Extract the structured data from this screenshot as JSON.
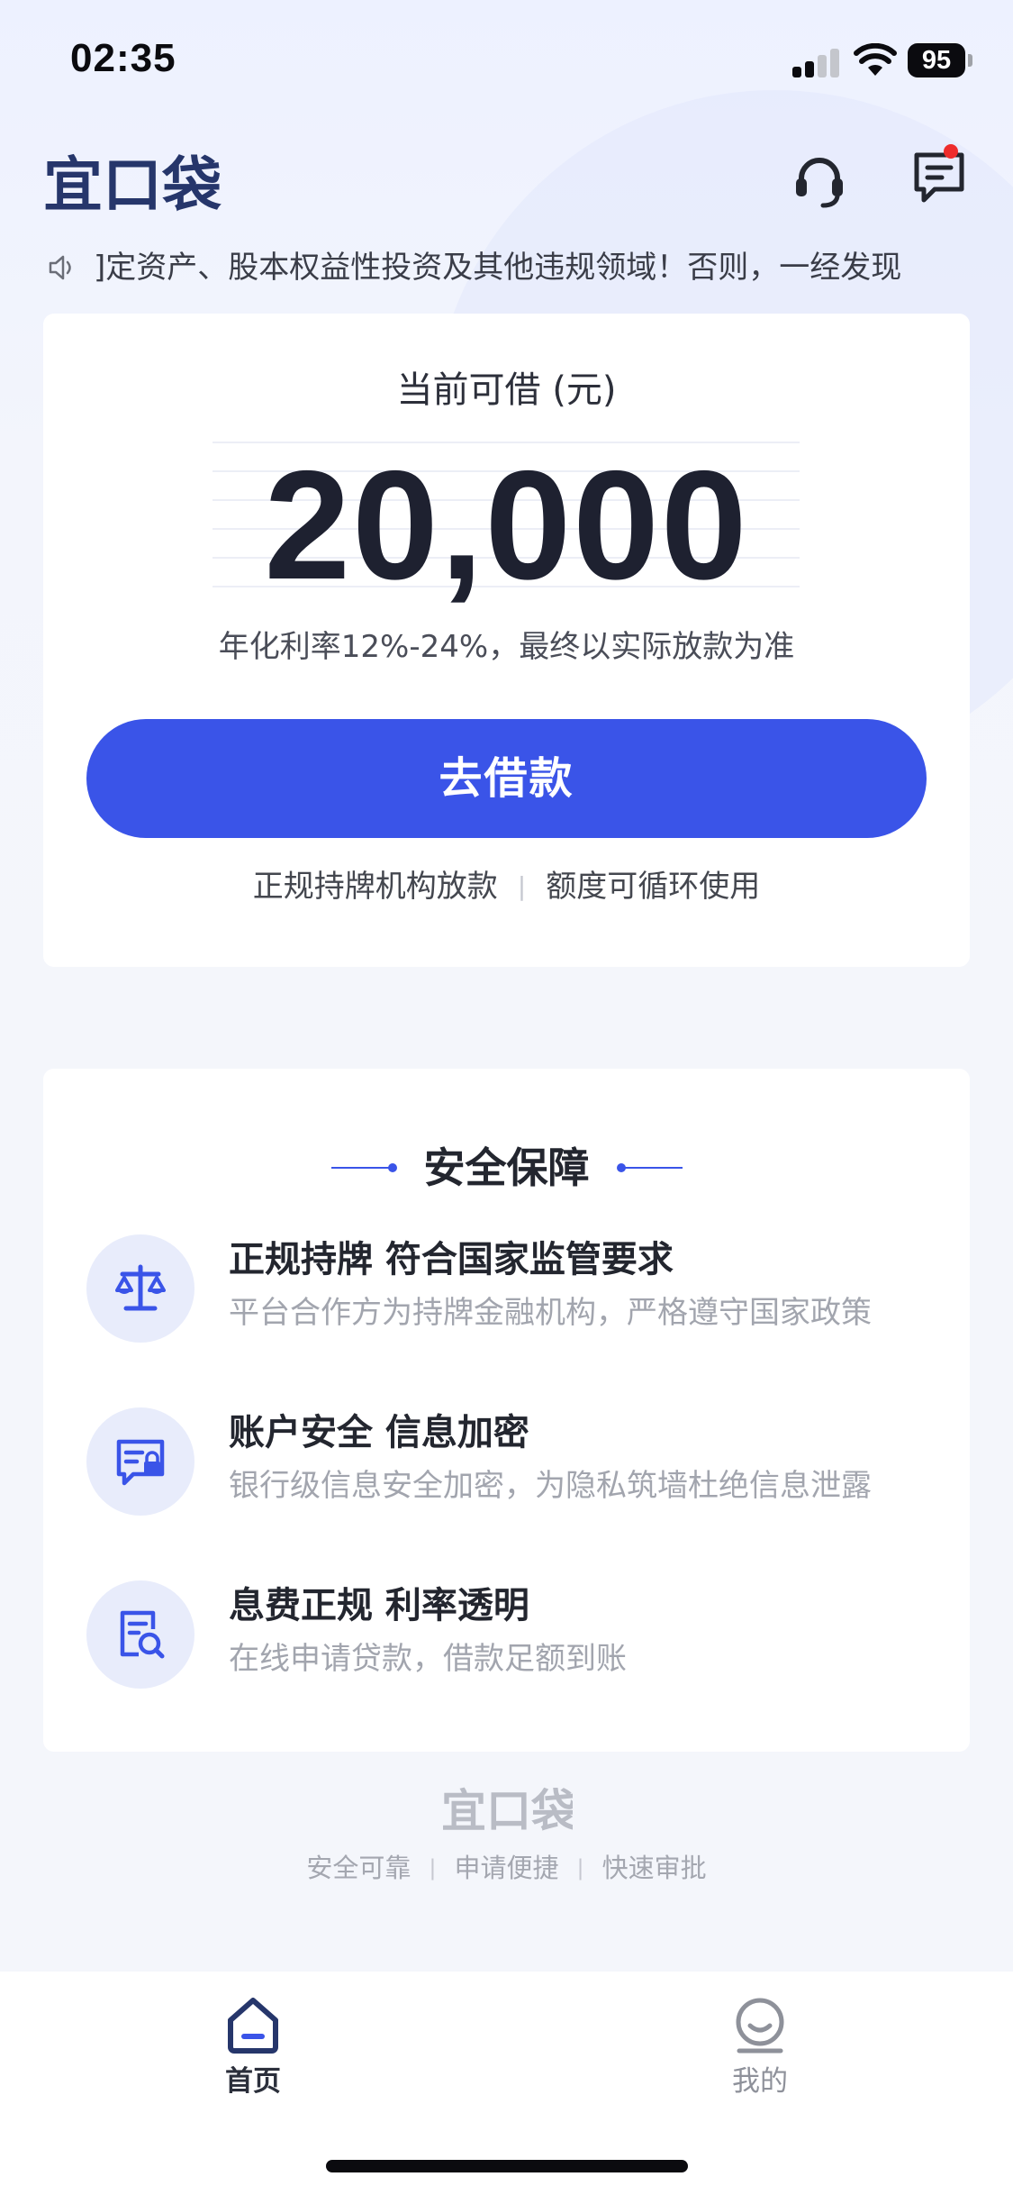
{
  "status_bar": {
    "time": "02:35",
    "battery": "95"
  },
  "header": {
    "logo_text": "宜口袋",
    "icons": [
      "customer-service-icon",
      "message-icon"
    ],
    "has_unread_messages": true
  },
  "notice": {
    "text": "]定资产、股本权益性投资及其他违规领域！否则，一经发现"
  },
  "loan_card": {
    "label": "当前可借 (元)",
    "amount": "20,000",
    "rate_note": "年化利率12%-24%，最终以实际放款为准",
    "button_label": "去借款",
    "features": [
      "正规持牌机构放款",
      "额度可循环使用"
    ]
  },
  "security": {
    "title": "安全保障",
    "items": [
      {
        "icon": "scale-icon",
        "title": "正规持牌 符合国家监管要求",
        "desc": "平台合作方为持牌金融机构，严格遵守国家政策"
      },
      {
        "icon": "secure-card-icon",
        "title": "账户安全 信息加密",
        "desc": "银行级信息安全加密，为隐私筑墙杜绝信息泄露"
      },
      {
        "icon": "document-search-icon",
        "title": "息费正规  利率透明",
        "desc": "在线申请贷款，借款足额到账"
      }
    ]
  },
  "footer": {
    "logo_text": "宜口袋",
    "tags": [
      "安全可靠",
      "申请便捷",
      "快速审批"
    ]
  },
  "tabbar": {
    "tabs": [
      {
        "label": "首页",
        "icon": "home-icon",
        "active": true
      },
      {
        "label": "我的",
        "icon": "profile-icon",
        "active": false
      }
    ]
  },
  "colors": {
    "primary": "#3a54e8",
    "brand_dark": "#26366b",
    "text_dark": "#23262f",
    "text_muted": "#a2a5ae",
    "unread_dot": "#ee2c2c"
  }
}
